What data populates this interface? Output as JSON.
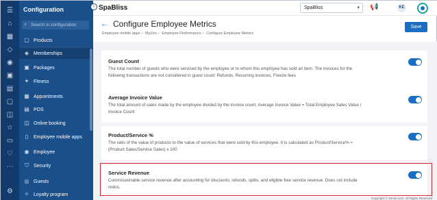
{
  "rail_icons": [
    "menu-icon",
    "home-icon",
    "calendar-icon",
    "tag-icon",
    "user-icon",
    "cart-icon",
    "chart-icon",
    "box-icon",
    "chat-icon",
    "star-icon",
    "clipboard-icon",
    "heart-icon",
    "settings-icon",
    "grid-icon"
  ],
  "sidebar": {
    "title": "Configuration",
    "search_placeholder": "Search in configuration",
    "items": [
      {
        "label": "Products",
        "icon": "box-icon"
      },
      {
        "label": "Memberships",
        "icon": "membership-icon",
        "active": true
      },
      {
        "label": "Packages",
        "icon": "package-icon"
      },
      {
        "label": "Fitness",
        "icon": "fitness-icon"
      },
      {
        "label": "Appointments",
        "icon": "calendar-icon"
      },
      {
        "label": "POS",
        "icon": "pos-icon"
      },
      {
        "label": "Online booking",
        "icon": "online-booking-icon"
      },
      {
        "label": "Employee mobile apps",
        "icon": "mobile-icon"
      },
      {
        "label": "Employee",
        "icon": "employee-icon"
      },
      {
        "label": "Security",
        "icon": "shield-icon"
      },
      {
        "label": "Guests",
        "icon": "guests-icon"
      },
      {
        "label": "Loyalty program",
        "icon": "loyalty-icon"
      }
    ]
  },
  "topbar": {
    "brand": "SpaBliss",
    "location": "SpaBliss",
    "avatar_initials": "KE"
  },
  "header": {
    "title": "Configure Employee Metrics",
    "breadcrumbs": [
      "Employee mobile apps",
      "MyZen",
      "Employee Performance",
      "Configure Employee Metrics"
    ],
    "save_label": "Save"
  },
  "metrics": [
    {
      "title": "Guest Count",
      "description": "The total number of guests who were serviced by the employee or to whom this employee has sold an item. The invoices for the following transactions are not considered in guest count: Refunds, Recurring invoices, Freeze fees",
      "enabled": true
    },
    {
      "title": "Average Invoice Value",
      "description": "The total amount of sales made by the employee divided by the invoice count. Average Invoice Value = Total Employee Sales Value / Invoice Count",
      "enabled": true
    },
    {
      "title": "Product/Service %",
      "description": "The ratio of the value of products to the value of services that were sold by this employee. It is calculated as Product/Service% = (Product Sales/Service Sales) x 100",
      "enabled": true
    },
    {
      "title": "Service Revenue",
      "description": "Commissionable service revenue after accounting for discounts, refunds, splits, and eligible free service revenue. Does not include redos.",
      "enabled": true
    }
  ],
  "footer": {
    "copyright": "Copyright © Zenoti.com. All Rights Reserved"
  },
  "colors": {
    "accent": "#1b6ec2",
    "sidebar": "#1b4f8a",
    "rail": "#123a6a",
    "highlight": "#d9222a"
  }
}
